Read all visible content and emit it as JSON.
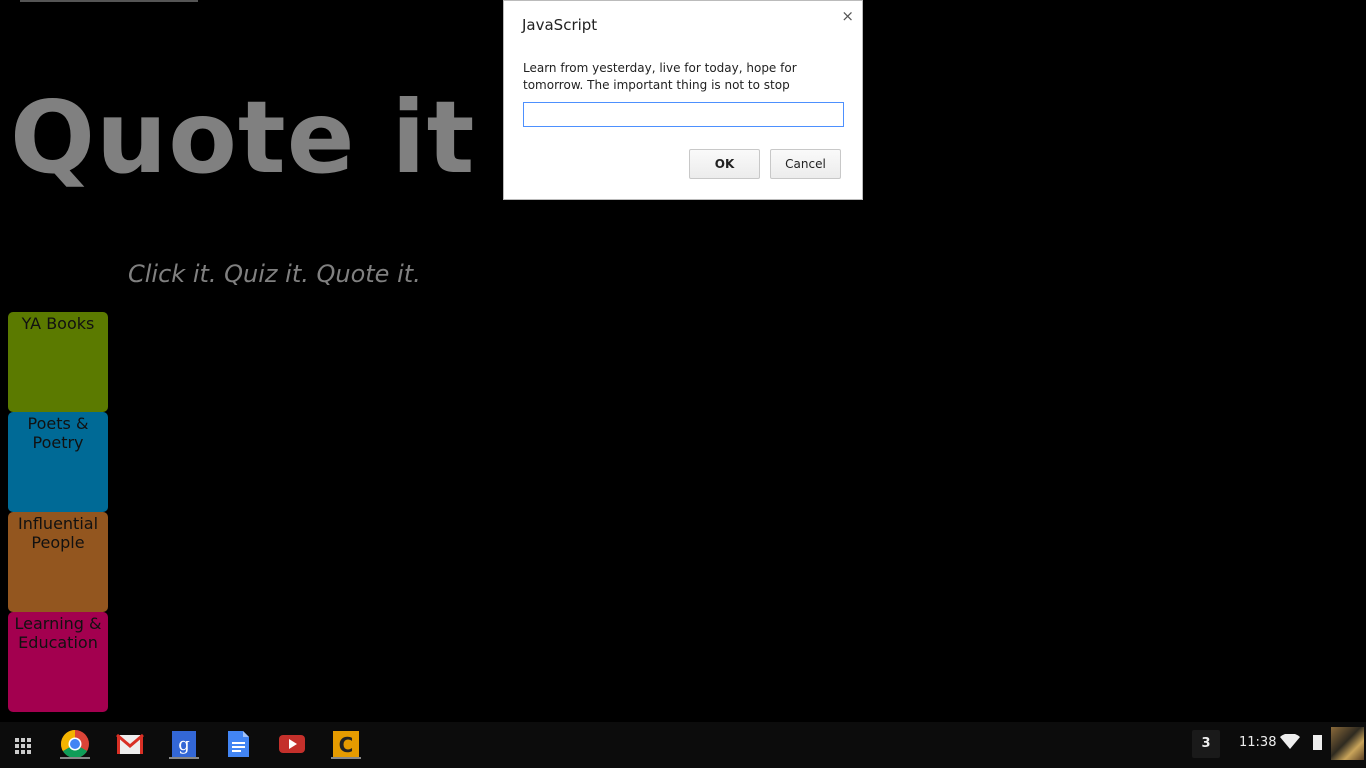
{
  "page": {
    "title": "Quote it",
    "tagline": "Click it. Quiz it. Quote it.",
    "categories": [
      {
        "line1": "YA Books",
        "line2": "",
        "color": "#5b7a00"
      },
      {
        "line1": "Poets &",
        "line2": "Poetry",
        "color": "#006a96"
      },
      {
        "line1": "Influential",
        "line2": "People",
        "color": "#93561f"
      },
      {
        "line1": "Learning &",
        "line2": "Education",
        "color": "#a3004f"
      }
    ]
  },
  "dialog": {
    "title": "JavaScript",
    "close_icon": "×",
    "message": "Learn from yesterday, live for today, hope for tomorrow. The important thing is not to stop",
    "input_value": "",
    "ok_label": "OK",
    "cancel_label": "Cancel"
  },
  "shelf": {
    "apps": [
      "launcher-icon",
      "chrome-icon",
      "gmail-icon",
      "google-search-icon",
      "docs-icon",
      "youtube-icon",
      "c-app-icon"
    ],
    "notification_count": "3",
    "time": "11:38",
    "wifi_icon": "wifi-icon",
    "battery_icon": "battery-icon",
    "avatar": "user-avatar"
  }
}
